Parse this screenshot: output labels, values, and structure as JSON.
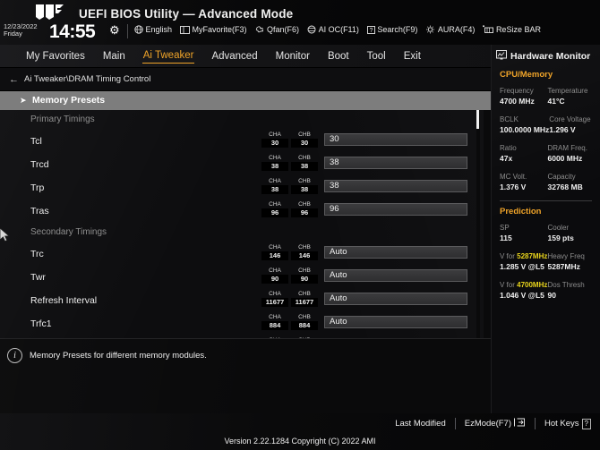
{
  "header": {
    "title": "UEFI BIOS Utility — Advanced Mode",
    "date": "12/23/2022",
    "day": "Friday",
    "time": "14:55",
    "gear_icon": "gear-icon",
    "logo": "tuf-logo",
    "tools": [
      {
        "label": "English",
        "icon": "globe-icon"
      },
      {
        "label": "MyFavorite(F3)",
        "icon": "book-icon"
      },
      {
        "label": "Qfan(F6)",
        "icon": "fan-icon"
      },
      {
        "label": "AI OC(F11)",
        "icon": "ai-chip-icon"
      },
      {
        "label": "Search(F9)",
        "icon": "question-box-icon"
      },
      {
        "label": "AURA(F4)",
        "icon": "aura-light-icon"
      },
      {
        "label": "ReSize BAR",
        "icon": "resize-bar-icon"
      }
    ]
  },
  "nav": {
    "tabs": [
      {
        "label": "My Favorites",
        "active": false
      },
      {
        "label": "Main",
        "active": false
      },
      {
        "label": "Ai Tweaker",
        "active": true
      },
      {
        "label": "Advanced",
        "active": false
      },
      {
        "label": "Monitor",
        "active": false
      },
      {
        "label": "Boot",
        "active": false
      },
      {
        "label": "Tool",
        "active": false
      },
      {
        "label": "Exit",
        "active": false
      }
    ]
  },
  "breadcrumb": {
    "back_icon": "back-arrow-icon",
    "path": "Ai Tweaker\\DRAM Timing Control"
  },
  "main": {
    "selected_row": {
      "label": "Memory Presets",
      "arrow": "submenu-arrow-icon"
    },
    "channel_headers": {
      "a": "CHA",
      "b": "CHB"
    },
    "sections": [
      {
        "title": "Primary Timings",
        "rows": [
          {
            "label": "Tcl",
            "cha": "30",
            "chb": "30",
            "value": "30"
          },
          {
            "label": "Trcd",
            "cha": "38",
            "chb": "38",
            "value": "38"
          },
          {
            "label": "Trp",
            "cha": "38",
            "chb": "38",
            "value": "38"
          },
          {
            "label": "Tras",
            "cha": "96",
            "chb": "96",
            "value": "96"
          }
        ]
      },
      {
        "title": "Secondary Timings",
        "rows": [
          {
            "label": "Trc",
            "cha": "146",
            "chb": "146",
            "value": "Auto"
          },
          {
            "label": "Twr",
            "cha": "90",
            "chb": "90",
            "value": "Auto"
          },
          {
            "label": "Refresh Interval",
            "cha": "11677",
            "chb": "11677",
            "value": "Auto"
          },
          {
            "label": "Trfc1",
            "cha": "884",
            "chb": "884",
            "value": "Auto"
          }
        ]
      }
    ]
  },
  "help": {
    "icon": "info-icon",
    "text": "Memory Presets for different memory modules."
  },
  "sidebar": {
    "icon": "monitor-icon",
    "title": "Hardware Monitor",
    "sections": [
      {
        "name": "CPU/Memory",
        "pairs": [
          [
            {
              "key": "Frequency",
              "value": "4700 MHz"
            },
            {
              "key": "Temperature",
              "value": "41°C"
            }
          ],
          [
            {
              "key": "BCLK",
              "value": "100.0000 MHz"
            },
            {
              "key": "Core Voltage",
              "value": "1.296 V"
            }
          ],
          [
            {
              "key": "Ratio",
              "value": "47x"
            },
            {
              "key": "DRAM Freq.",
              "value": "6000 MHz"
            }
          ],
          [
            {
              "key": "MC Volt.",
              "value": "1.376 V"
            },
            {
              "key": "Capacity",
              "value": "32768 MB"
            }
          ]
        ]
      },
      {
        "name": "Prediction",
        "pairs": [
          [
            {
              "key": "SP",
              "value": "115"
            },
            {
              "key": "Cooler",
              "value": "159 pts"
            }
          ],
          [
            {
              "key": "V for ",
              "key_hl": "5287MHz",
              "value": "1.285 V @L5"
            },
            {
              "key": "Heavy Freq",
              "value": "5287MHz"
            }
          ],
          [
            {
              "key": "V for ",
              "key_hl": "4700MHz",
              "value": "1.046 V @L5"
            },
            {
              "key": "Dos Thresh",
              "value": "90"
            }
          ]
        ]
      }
    ]
  },
  "footer": {
    "last_modified": "Last Modified",
    "ezmode": "EzMode(F7)",
    "ezmode_icon": "exit-arrow-icon",
    "hotkeys": "Hot Keys",
    "hotkeys_key": "?",
    "version": "Version 2.22.1284 Copyright (C) 2022 AMI"
  },
  "colors": {
    "accent": "#f0a429",
    "highlight": "#e8d41c",
    "selected_row": "#7d7d7d"
  }
}
